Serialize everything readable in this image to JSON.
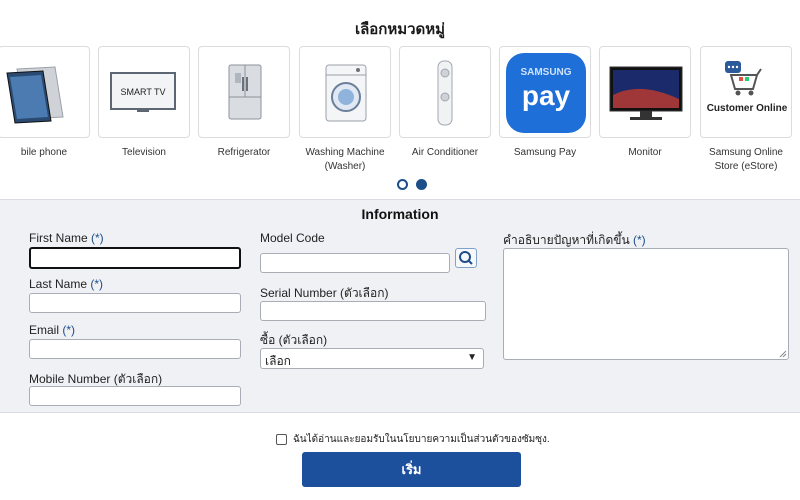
{
  "categories_title": "เลือกหมวดหมู่",
  "categories": [
    {
      "label": "bile phone",
      "icon": "mobile-phone-icon"
    },
    {
      "label": "Television",
      "icon": "television-icon",
      "tv_text": "SMART TV"
    },
    {
      "label": "Refrigerator",
      "icon": "refrigerator-icon"
    },
    {
      "label": "Washing Machine (Washer)",
      "icon": "washing-machine-icon"
    },
    {
      "label": "Air Conditioner",
      "icon": "air-conditioner-icon"
    },
    {
      "label": "Samsung Pay",
      "icon": "samsung-pay-logo",
      "logo_top": "SAMSUNG",
      "logo_main": "pay"
    },
    {
      "label": "Monitor",
      "icon": "monitor-icon"
    },
    {
      "label": "Samsung Online Store (eStore)",
      "icon": "customer-online-cart-icon",
      "logo_text": "Customer Online"
    }
  ],
  "carousel": {
    "pages": 2,
    "active_page": 2
  },
  "form": {
    "title": "Information",
    "required_mark": "(*)",
    "first_name": {
      "label": "First Name",
      "value": ""
    },
    "last_name": {
      "label": "Last Name",
      "value": ""
    },
    "email": {
      "label": "Email",
      "value": ""
    },
    "mobile": {
      "label": "Mobile Number (ตัวเลือก)",
      "value": ""
    },
    "model_code": {
      "label": "Model Code",
      "value": ""
    },
    "serial_number": {
      "label": "Serial Number (ตัวเลือก)",
      "value": ""
    },
    "purchase": {
      "label": "ซื้อ (ตัวเลือก)",
      "selected": "เลือก"
    },
    "problem": {
      "label": "คำอธิบายปัญหาที่เกิดขึ้น",
      "value": ""
    }
  },
  "consent": {
    "label": "ฉันได้อ่านและยอมรับในนโยบายความเป็นส่วนตัวของซัมซุง.",
    "checked": false
  },
  "start_button": "เริ่ม",
  "colors": {
    "brand_blue": "#1c4f9c",
    "required": "#1d4e89",
    "panel_bg": "#f0f1f4",
    "samsung_pay_blue": "#1f6fd8"
  }
}
